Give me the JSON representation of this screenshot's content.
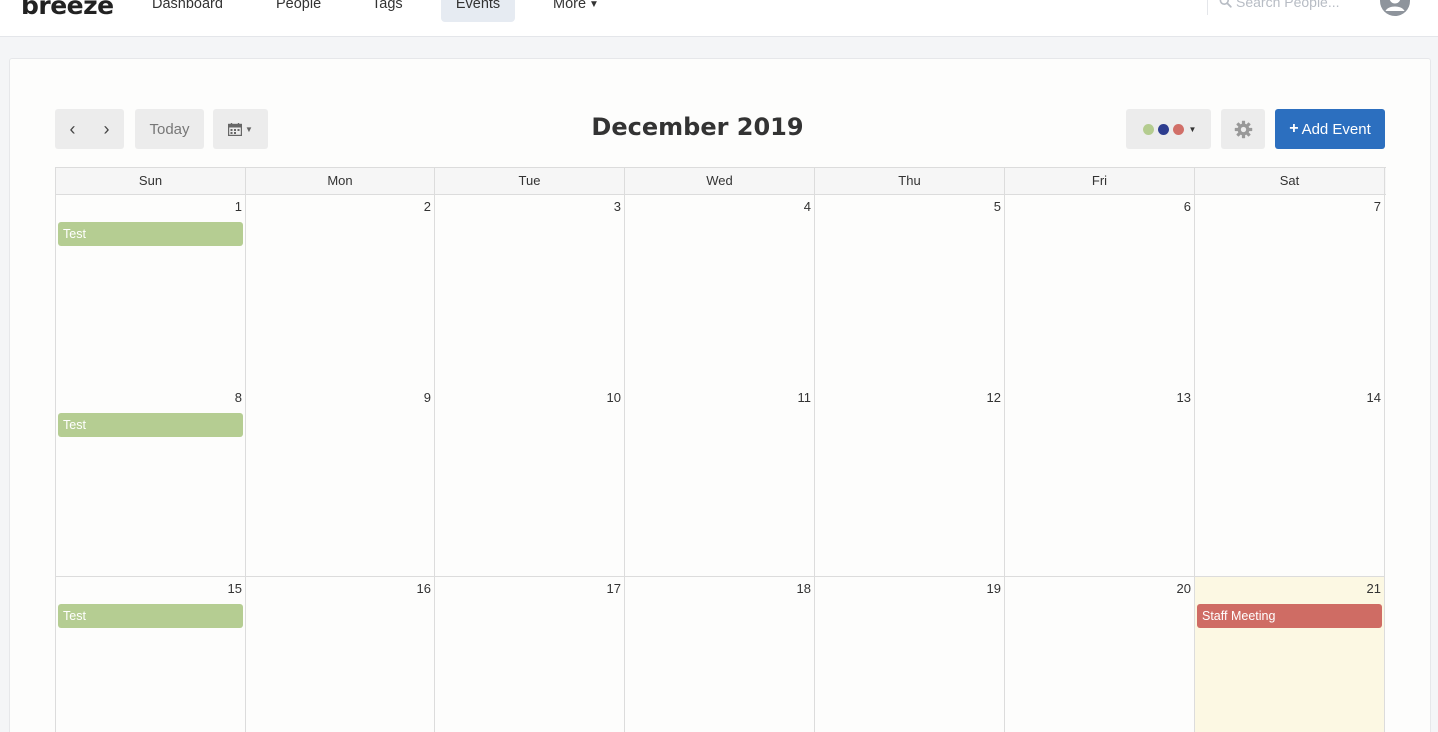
{
  "nav": {
    "logo": "breeze",
    "items": [
      {
        "label": "Dashboard"
      },
      {
        "label": "People"
      },
      {
        "label": "Tags"
      },
      {
        "label": "Events"
      },
      {
        "label": "More"
      }
    ],
    "active": "Events",
    "search_placeholder": "Search People...",
    "search_icon": "search-icon",
    "avatar_icon": "user-circle-icon"
  },
  "toolbar": {
    "prev_icon": "chevron-left-icon",
    "next_icon": "chevron-right-icon",
    "prev_glyph": "‹",
    "next_glyph": "›",
    "today_label": "Today",
    "view_icon": "calendar-icon",
    "title": "December 2019",
    "color_filter_dots": [
      "#b4cc8f",
      "#2d3d8f",
      "#d16f68"
    ],
    "settings_icon": "gear-icon",
    "add_label": "Add Event",
    "add_glyph": "+",
    "accent": "#2c6fbf"
  },
  "calendar": {
    "weekdays": [
      "Sun",
      "Mon",
      "Tue",
      "Wed",
      "Thu",
      "Fri",
      "Sat"
    ],
    "weeks": [
      [
        "1",
        "2",
        "3",
        "4",
        "5",
        "6",
        "7"
      ],
      [
        "8",
        "9",
        "10",
        "11",
        "12",
        "13",
        "14"
      ],
      [
        "15",
        "16",
        "17",
        "18",
        "19",
        "20",
        "21"
      ]
    ],
    "today": "21",
    "events": [
      {
        "day": "1",
        "title": "Test",
        "color": "#b5cd92"
      },
      {
        "day": "8",
        "title": "Test",
        "color": "#b5cd92"
      },
      {
        "day": "15",
        "title": "Test",
        "color": "#b5cd92"
      },
      {
        "day": "21",
        "title": "Staff Meeting",
        "color": "#cf6c64"
      }
    ]
  }
}
